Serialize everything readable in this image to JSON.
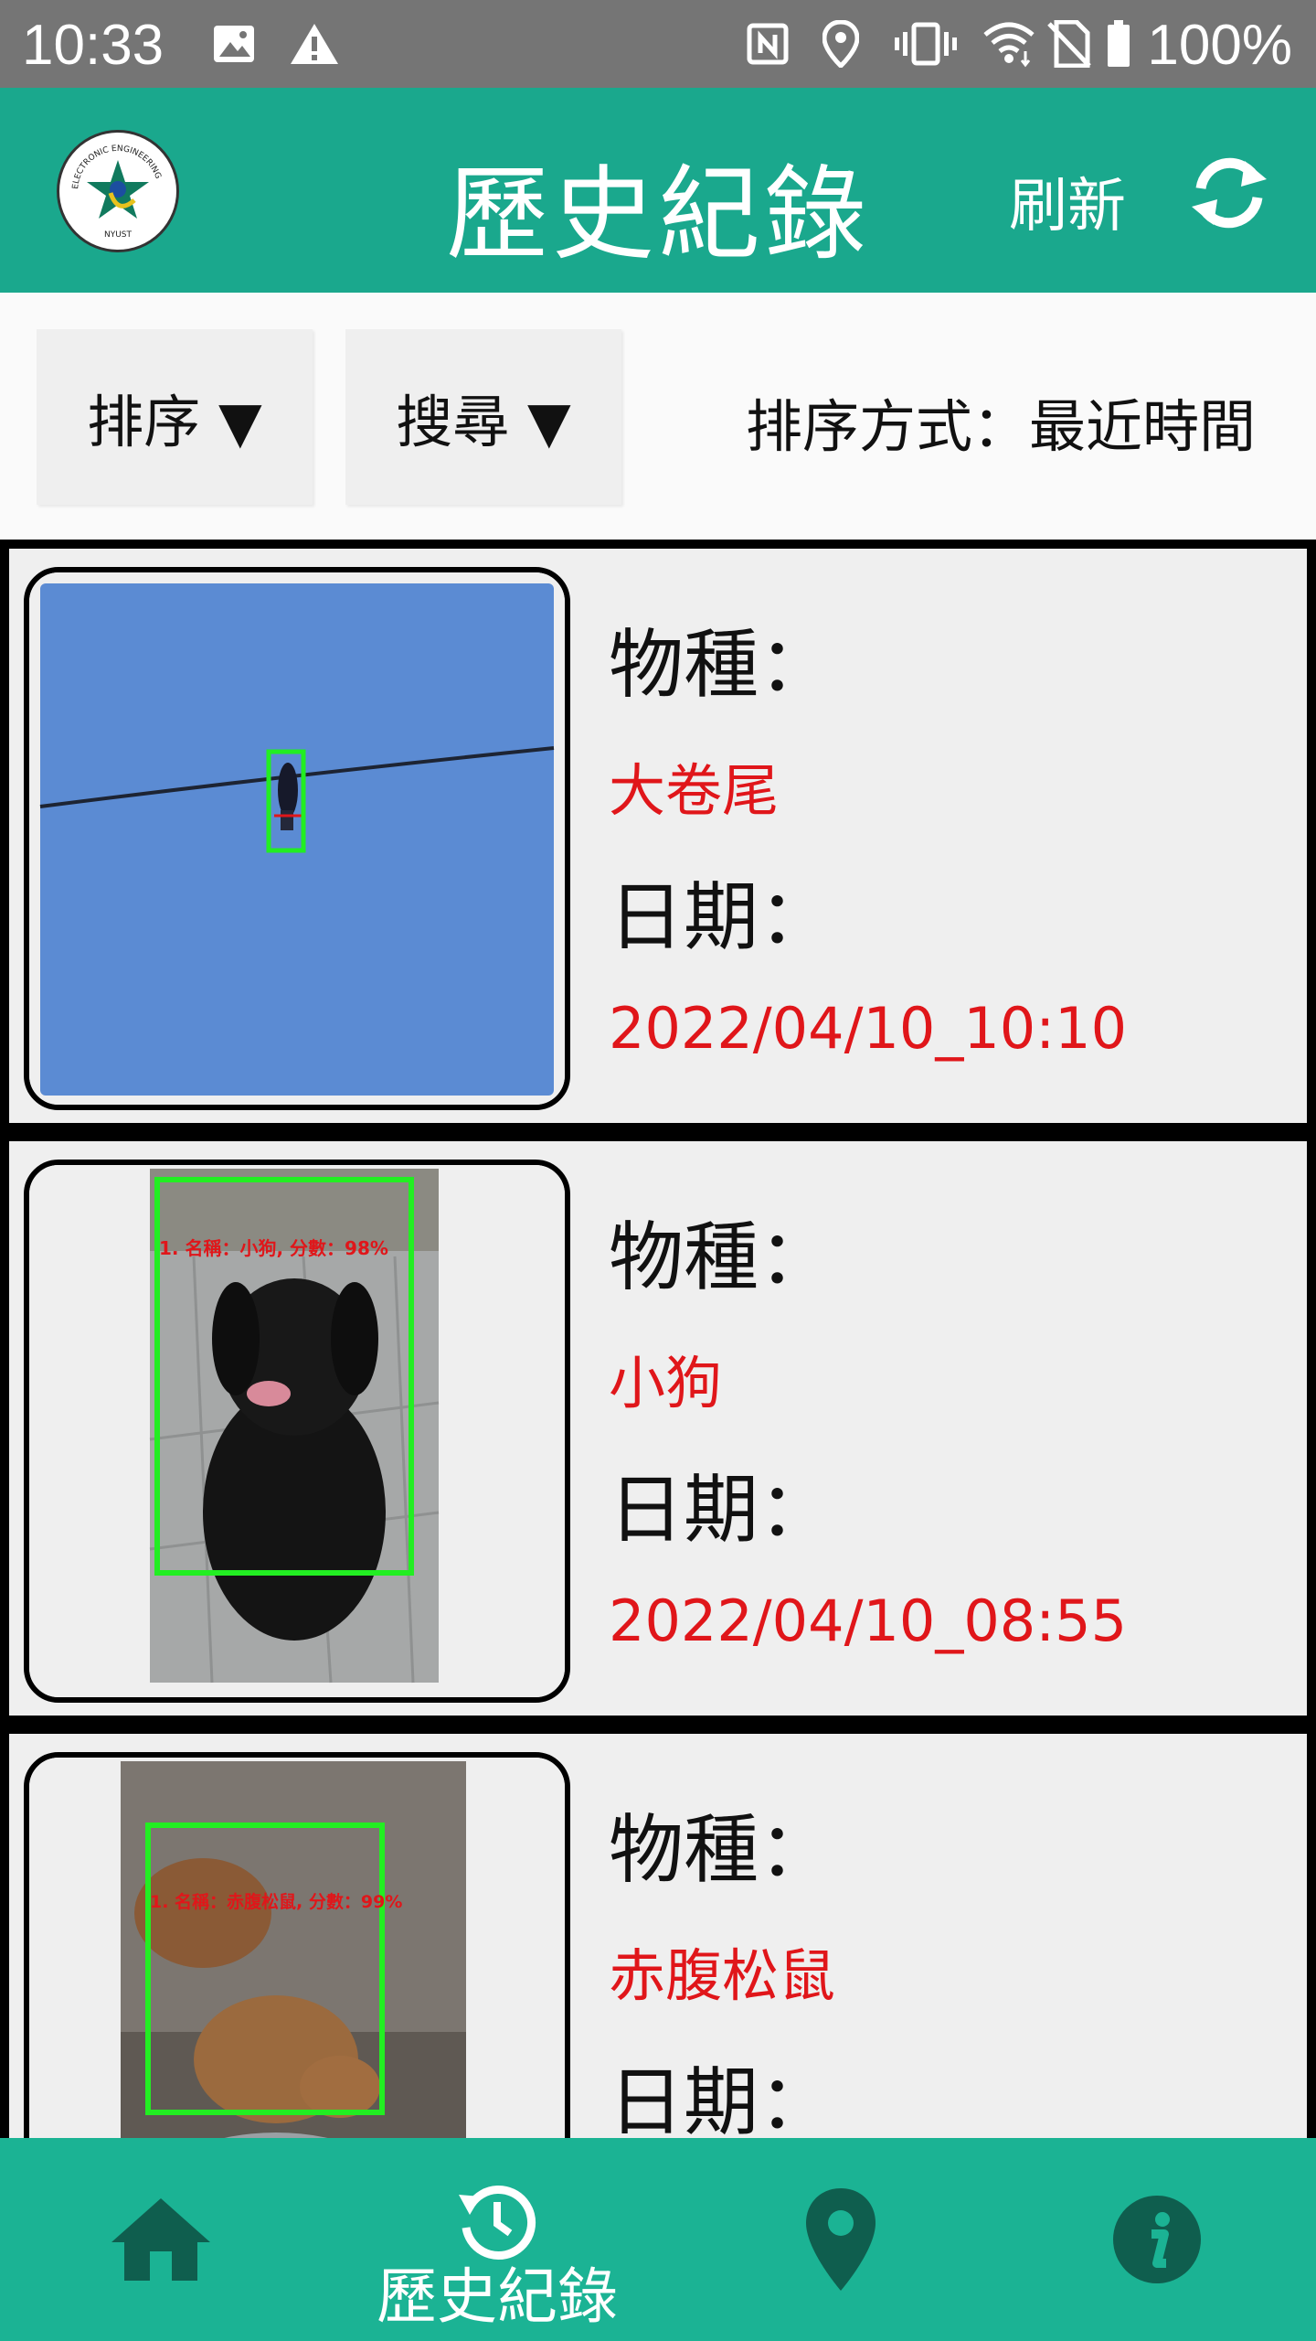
{
  "status_bar": {
    "time": "10:33",
    "battery_text": "100%",
    "icons": [
      "image-icon",
      "warning-icon",
      "nfc-icon",
      "location-icon",
      "vibrate-icon",
      "wifi-icon",
      "no-sim-icon",
      "battery-icon"
    ]
  },
  "app_bar": {
    "title": "歷史紀錄",
    "refresh_label": "刷新",
    "logo_text_top": "ELECTRONIC ENGINEERING",
    "logo_text_bottom": "NYUST",
    "color": "#1aa88d"
  },
  "toolbar": {
    "sort_button": "排序 ▼",
    "search_button": "搜尋 ▼",
    "sort_status": "排序方式：最近時間"
  },
  "records": [
    {
      "species_label": "物種：",
      "species": "大卷尾",
      "date_label": "日期：",
      "date": "2022/04/10_10:10"
    },
    {
      "species_label": "物種：",
      "species": "小狗",
      "date_label": "日期：",
      "date": "2022/04/10_08:55",
      "detection_text": "1. 名稱：小狗, 分數：98%"
    },
    {
      "species_label": "物種：",
      "species": "赤腹松鼠",
      "date_label": "日期：",
      "detection_text": "1. 名稱：赤腹松鼠, 分數：99%"
    }
  ],
  "bottom_nav": {
    "active_label": "歷史紀錄",
    "items": [
      "home-icon",
      "history-icon",
      "map-pin-icon",
      "info-icon"
    ],
    "color": "#1bb394"
  },
  "colors": {
    "accent_red": "#e0161a",
    "detect_green": "#22ee22"
  }
}
